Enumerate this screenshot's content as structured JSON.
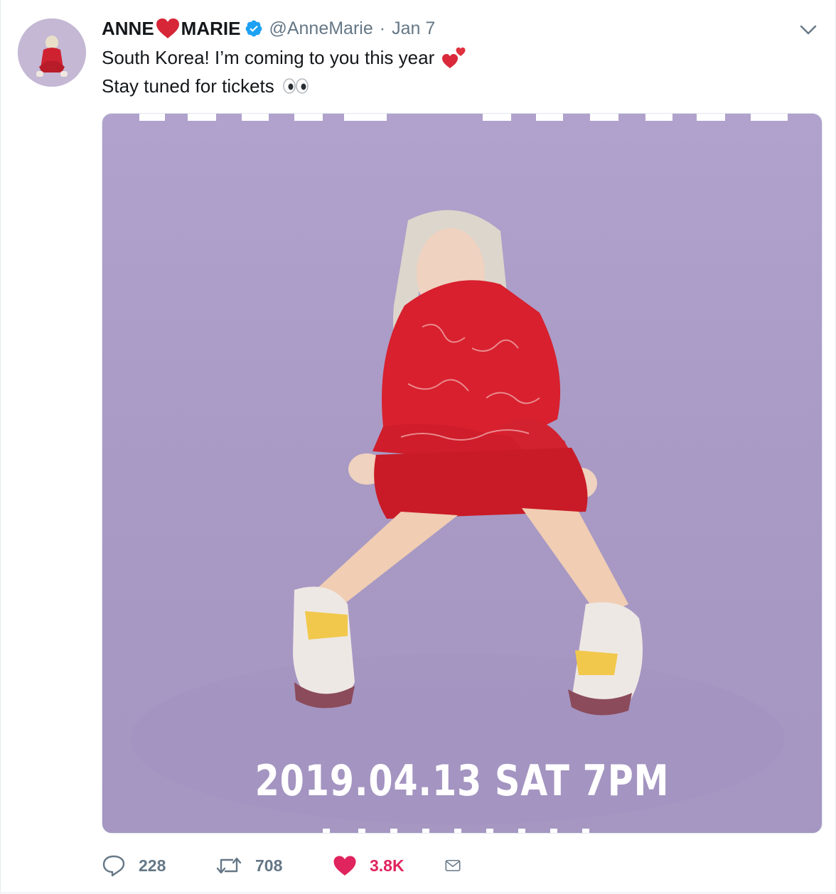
{
  "tweet": {
    "author": {
      "name_part1": "ANNE",
      "name_part2": "MARIE",
      "handle": "@AnneMarie",
      "separator": "·",
      "date": "Jan 7"
    },
    "text_line1": "South Korea! I’m coming to you this year",
    "text_line2": "Stay tuned for tickets",
    "emojis": {
      "line1": "two-hearts-icon",
      "line2": "eyes-icon"
    },
    "media": {
      "poster_date": "2019.04.13 SAT 7PM"
    },
    "actions": {
      "replies": "228",
      "retweets": "708",
      "likes": "3.8K"
    }
  },
  "colors": {
    "verified": "#1da1f2",
    "like": "#e0245e",
    "secondary_text": "#657786",
    "poster_background": "#ab9dc6",
    "outfit_red": "#d8202e"
  }
}
